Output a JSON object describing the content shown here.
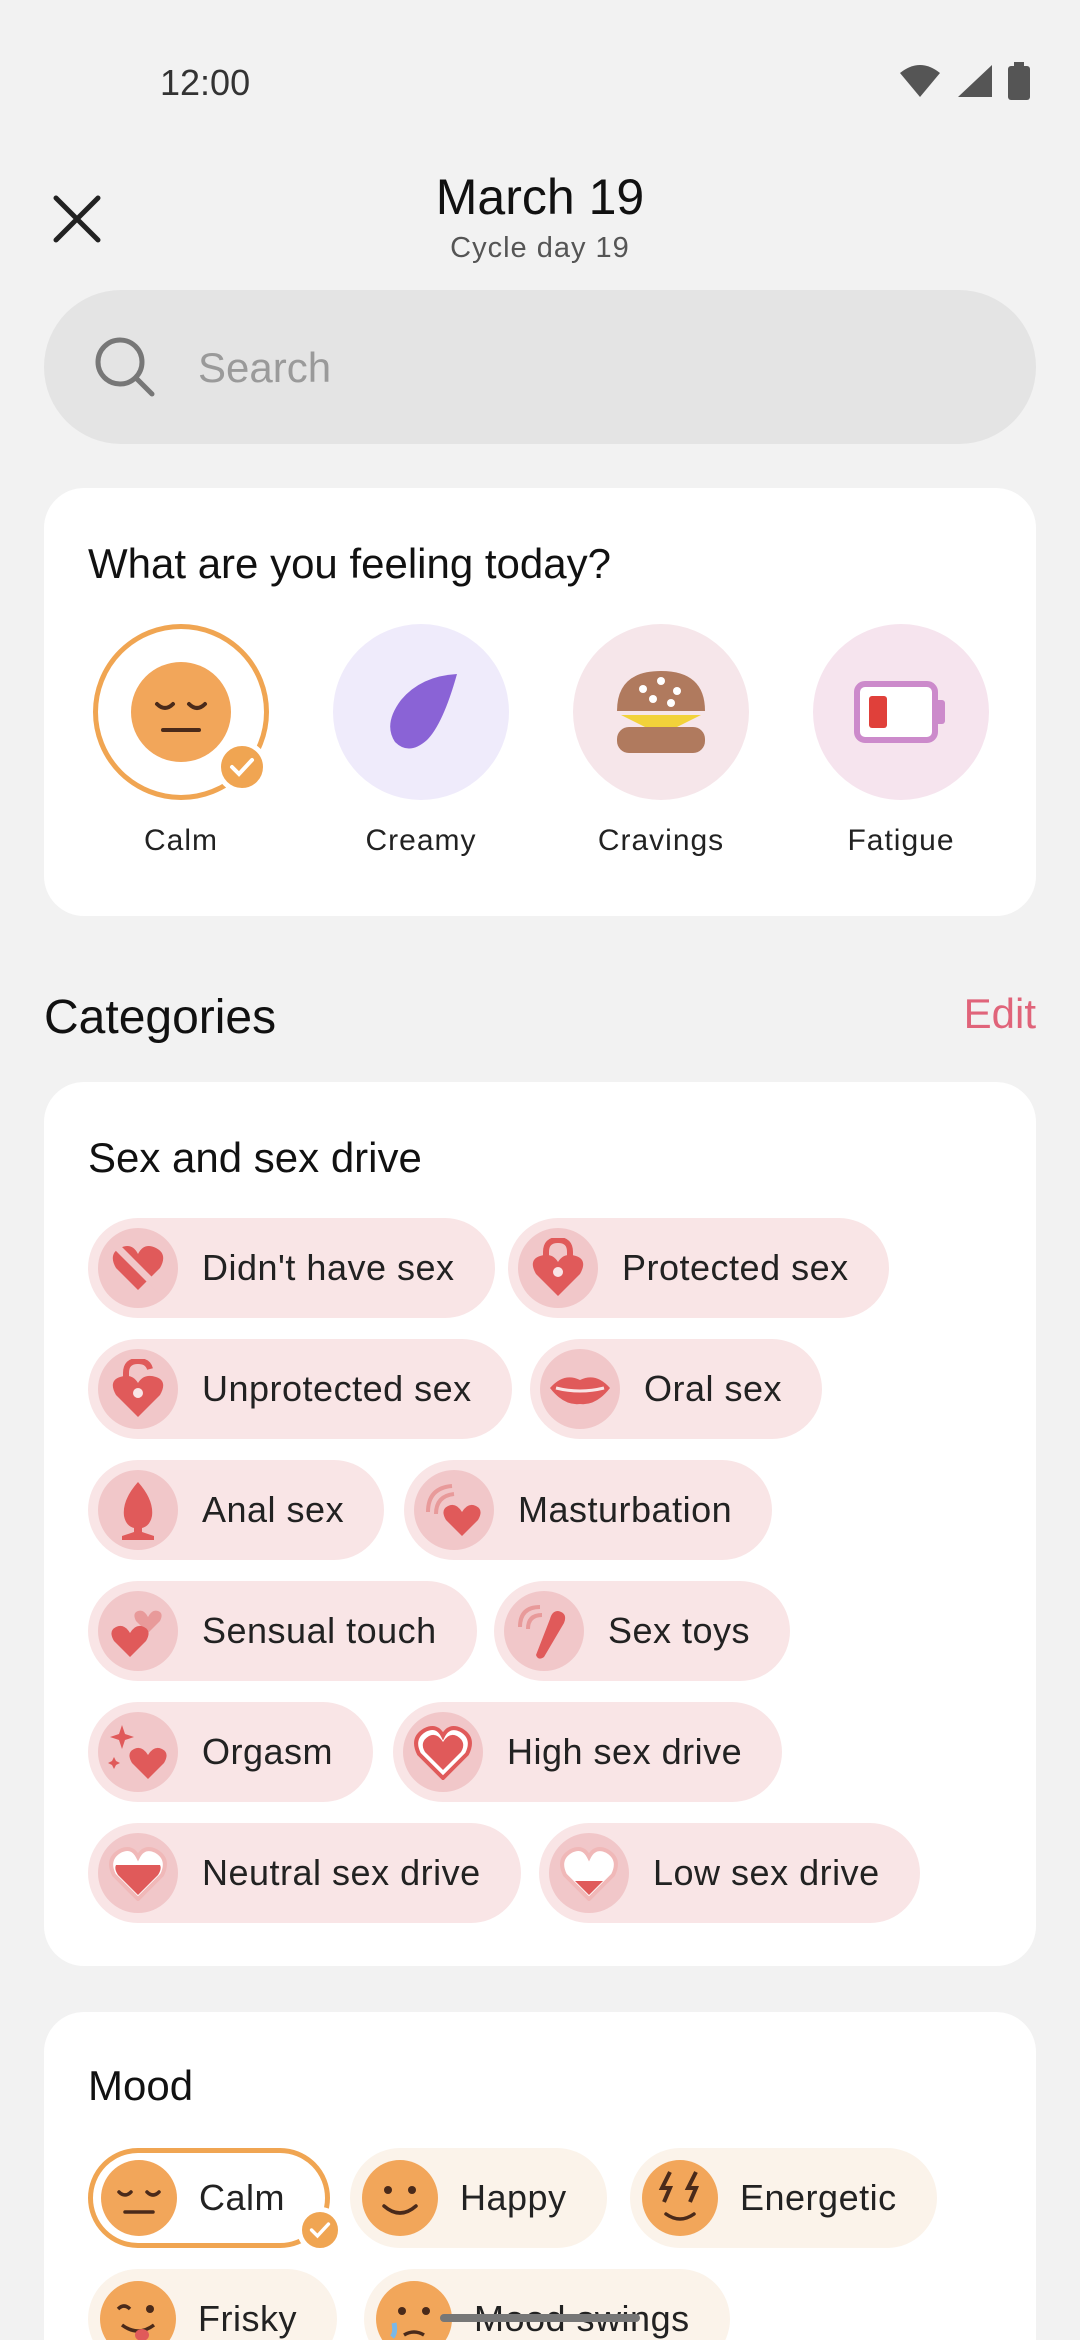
{
  "status": {
    "time": "12:00"
  },
  "header": {
    "title": "March 19",
    "subtitle": "Cycle day 19"
  },
  "search": {
    "placeholder": "Search"
  },
  "feeling": {
    "title": "What are you feeling today?",
    "items": [
      {
        "label": "Calm",
        "icon": "calm-face-icon",
        "selected": true
      },
      {
        "label": "Creamy",
        "icon": "drop-icon",
        "selected": false
      },
      {
        "label": "Cravings",
        "icon": "burger-icon",
        "selected": false
      },
      {
        "label": "Fatigue",
        "icon": "low-battery-icon",
        "selected": false
      }
    ]
  },
  "categories": {
    "title": "Categories",
    "edit_label": "Edit"
  },
  "sex_section": {
    "title": "Sex and sex drive",
    "chips": [
      {
        "label": "Didn't have sex",
        "icon": "crossed-heart-icon"
      },
      {
        "label": "Protected sex",
        "icon": "locked-heart-icon"
      },
      {
        "label": "Unprotected sex",
        "icon": "unlocked-heart-icon"
      },
      {
        "label": "Oral sex",
        "icon": "lips-icon"
      },
      {
        "label": "Anal sex",
        "icon": "plug-icon"
      },
      {
        "label": "Masturbation",
        "icon": "heart-waves-icon"
      },
      {
        "label": "Sensual touch",
        "icon": "two-hearts-icon"
      },
      {
        "label": "Sex toys",
        "icon": "toy-icon"
      },
      {
        "label": "Orgasm",
        "icon": "sparkle-heart-icon"
      },
      {
        "label": "High sex drive",
        "icon": "heart-full-icon"
      },
      {
        "label": "Neutral sex drive",
        "icon": "heart-half-icon"
      },
      {
        "label": "Low sex drive",
        "icon": "heart-low-icon"
      }
    ]
  },
  "mood_section": {
    "title": "Mood",
    "chips": [
      {
        "label": "Calm",
        "icon": "calm-face-icon",
        "selected": true
      },
      {
        "label": "Happy",
        "icon": "happy-face-icon",
        "selected": false
      },
      {
        "label": "Energetic",
        "icon": "energetic-face-icon",
        "selected": false
      },
      {
        "label": "Frisky",
        "icon": "frisky-face-icon",
        "selected": false
      },
      {
        "label": "Mood swings",
        "icon": "mood-swings-face-icon",
        "selected": false
      }
    ]
  },
  "colors": {
    "accent": "#e0647a",
    "selected": "#f0a552",
    "chip_bg": "#f9e5e6"
  }
}
